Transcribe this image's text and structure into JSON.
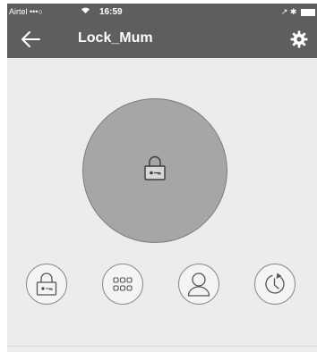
{
  "status_bar": {
    "carrier": "Airtel •••○",
    "wifi_icon": "wifi-icon",
    "time": "16:59",
    "right_icons": "↗ ✱"
  },
  "header": {
    "title": "Lock_Mum",
    "back_icon": "arrow-left-icon",
    "settings_icon": "gear-icon"
  },
  "main": {
    "primary_button_icon": "padlock-icon"
  },
  "actions": [
    {
      "name": "lock",
      "icon": "padlock-icon"
    },
    {
      "name": "keypad",
      "icon": "keypad-icon"
    },
    {
      "name": "user",
      "icon": "user-icon"
    },
    {
      "name": "history",
      "icon": "history-clock-icon"
    }
  ],
  "colors": {
    "bar": "#5e5e5e",
    "background": "#ececec",
    "circle": "#a6a6a6"
  }
}
